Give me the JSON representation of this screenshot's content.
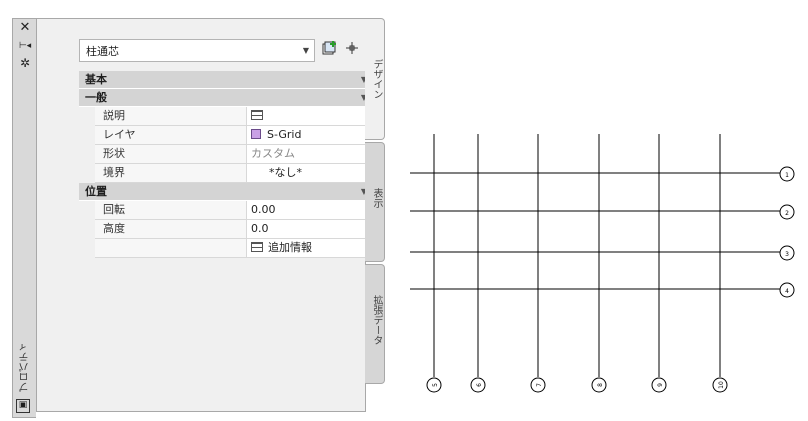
{
  "palette": {
    "title": "プロパティ",
    "tabs": {
      "design": "デザイン",
      "display": "表示",
      "extended_data": "拡張データ"
    }
  },
  "style_dropdown": {
    "value": "柱通芯"
  },
  "toolbar": {
    "icons": [
      "add-selected-icon",
      "quick-select-icon",
      "select-objects-icon"
    ]
  },
  "properties": {
    "basic": {
      "label": "基本",
      "general": {
        "label": "一般",
        "rows": [
          {
            "key": "説明",
            "value": ""
          },
          {
            "key": "レイヤ",
            "value": "S-Grid"
          },
          {
            "key": "形状",
            "value": "カスタム"
          },
          {
            "key": "境界",
            "value": "*なし*"
          }
        ]
      }
    },
    "location": {
      "label": "位置",
      "rows": [
        {
          "key": "回転",
          "value": "0.00"
        },
        {
          "key": "高度",
          "value": "0.0"
        },
        {
          "key": "",
          "value": "追加情報"
        }
      ]
    }
  },
  "colors": {
    "layer_swatch": "#c9a0e6",
    "panel": "#f0f0f0",
    "category": "#d4d4d4"
  },
  "grid_drawing": {
    "horizontal_labels": [
      "1",
      "2",
      "3",
      "4"
    ],
    "vertical_labels": [
      "5",
      "6",
      "7",
      "8",
      "9",
      "10"
    ]
  }
}
